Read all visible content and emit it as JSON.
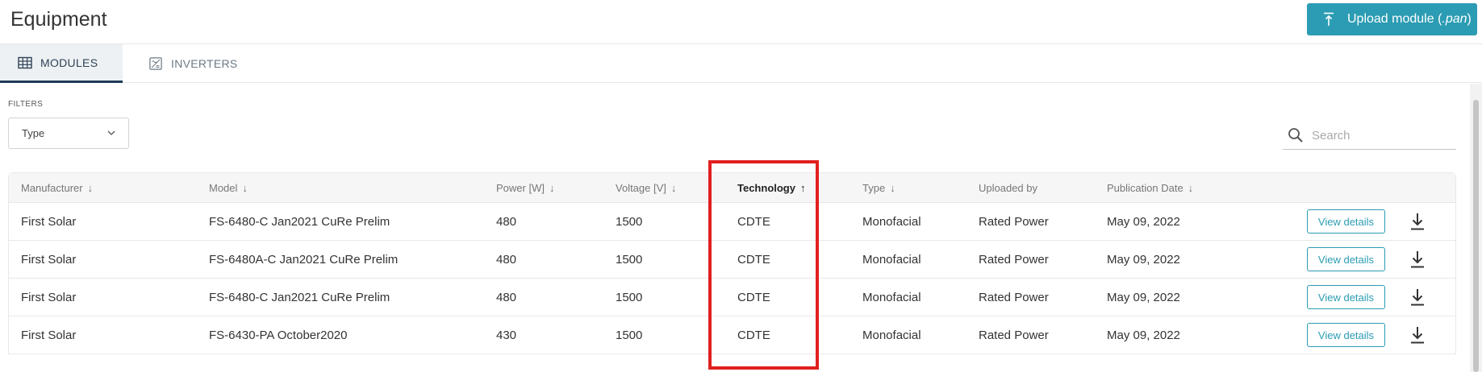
{
  "header": {
    "title": "Equipment",
    "upload_label": "Upload module (",
    "upload_ext": ".pan",
    "upload_suffix": ")"
  },
  "tabs": [
    {
      "label": "MODULES",
      "icon": "grid-icon",
      "active": true
    },
    {
      "label": "INVERTERS",
      "icon": "inverter-icon",
      "active": false
    }
  ],
  "filters": {
    "label": "FILTERS",
    "type_select": "Type"
  },
  "search": {
    "placeholder": "Search"
  },
  "table": {
    "columns": [
      {
        "label": "Manufacturer",
        "sort": "↓"
      },
      {
        "label": "Model",
        "sort": "↓"
      },
      {
        "label": "Power [W]",
        "sort": "↓"
      },
      {
        "label": "Voltage [V]",
        "sort": "↓"
      },
      {
        "label": "Technology",
        "sort": "↑",
        "active": true
      },
      {
        "label": "Type",
        "sort": "↓"
      },
      {
        "label": "Uploaded by",
        "sort": ""
      },
      {
        "label": "Publication Date",
        "sort": "↓"
      }
    ],
    "rows": [
      {
        "manufacturer": "First Solar",
        "model": "FS-6480-C Jan2021 CuRe Prelim",
        "power": "480",
        "voltage": "1500",
        "technology": "CDTE",
        "type": "Monofacial",
        "uploaded_by": "Rated Power",
        "date": "May 09, 2022",
        "action": "View details"
      },
      {
        "manufacturer": "First Solar",
        "model": "FS-6480A-C Jan2021 CuRe Prelim",
        "power": "480",
        "voltage": "1500",
        "technology": "CDTE",
        "type": "Monofacial",
        "uploaded_by": "Rated Power",
        "date": "May 09, 2022",
        "action": "View details"
      },
      {
        "manufacturer": "First Solar",
        "model": "FS-6480-C Jan2021 CuRe Prelim",
        "power": "480",
        "voltage": "1500",
        "technology": "CDTE",
        "type": "Monofacial",
        "uploaded_by": "Rated Power",
        "date": "May 09, 2022",
        "action": "View details"
      },
      {
        "manufacturer": "First Solar",
        "model": "FS-6430-PA October2020",
        "power": "430",
        "voltage": "1500",
        "technology": "CDTE",
        "type": "Monofacial",
        "uploaded_by": "Rated Power",
        "date": "May 09, 2022",
        "action": "View details"
      }
    ]
  },
  "colors": {
    "accent": "#2b9cb3",
    "active_tab_border": "#1f3b57",
    "highlight": "#e02020"
  }
}
